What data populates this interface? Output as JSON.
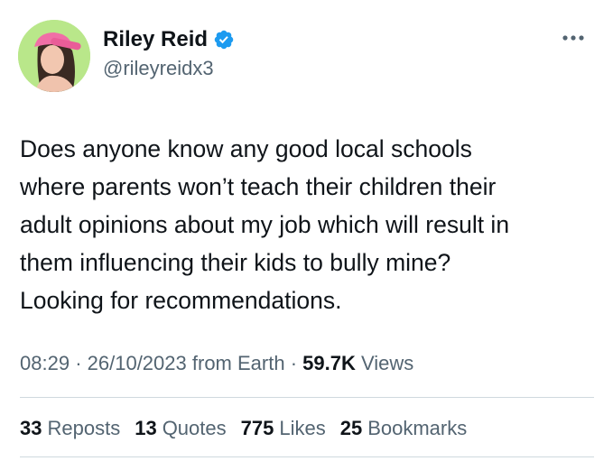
{
  "author": {
    "display_name": "Riley Reid",
    "handle": "@rileyreidx3",
    "verified": true
  },
  "tweet": {
    "text": "Does anyone know any good local schools\nwhere parents won’t teach their children their\nadult opinions about my job which will result in\nthem influencing their kids to bully mine?\nLooking for recommendations."
  },
  "meta": {
    "time": "08:29",
    "separator": "·",
    "date": "26/10/2023",
    "source": "from Earth",
    "views_count": "59.7K",
    "views_label": "Views"
  },
  "stats": [
    {
      "count": "33",
      "label": "Reposts"
    },
    {
      "count": "13",
      "label": "Quotes"
    },
    {
      "count": "775",
      "label": "Likes"
    },
    {
      "count": "25",
      "label": "Bookmarks"
    }
  ],
  "icons": {
    "verified": "verified-badge-icon",
    "more": "more-horizontal-icon"
  },
  "colors": {
    "text_primary": "#0f1419",
    "text_secondary": "#536471",
    "verified_blue": "#1d9bf0",
    "divider": "#cfd9de",
    "avatar_bg": "#b9e78a"
  }
}
